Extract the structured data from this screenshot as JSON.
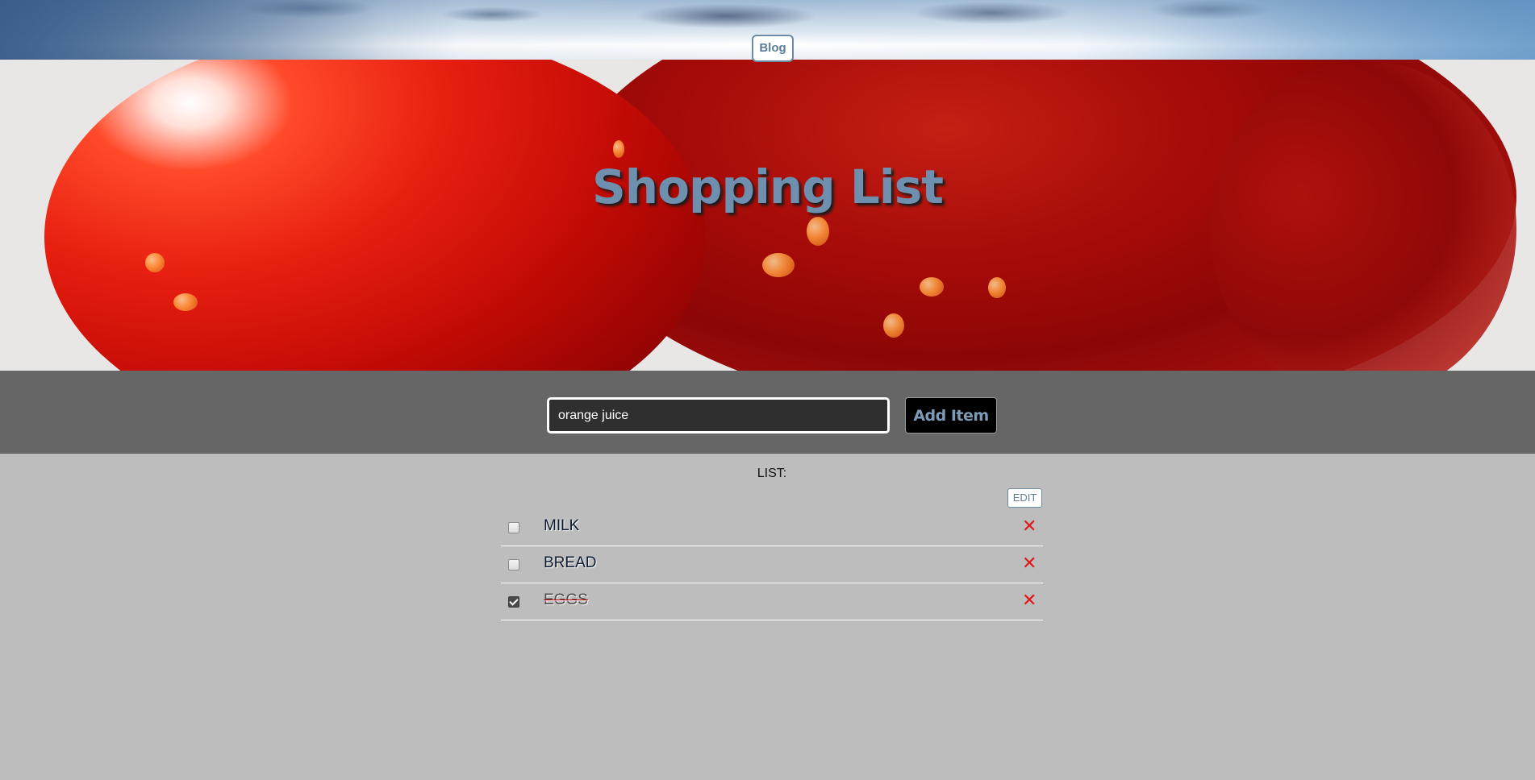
{
  "nav": {
    "blog_label": "Blog"
  },
  "header": {
    "title": "Shopping List"
  },
  "add_bar": {
    "input_value": "orange juice",
    "button_label": "Add Item"
  },
  "list": {
    "heading": "LIST:",
    "edit_label": "EDIT",
    "items": [
      {
        "label": "MILK",
        "checked": false
      },
      {
        "label": "BREAD",
        "checked": false
      },
      {
        "label": "EGGS",
        "checked": true
      }
    ],
    "delete_glyph": "✕"
  },
  "colors": {
    "title": "#6f8fae",
    "add_bar_bg": "#666666",
    "page_bg": "#bdbdbd",
    "delete": "#e0161b"
  }
}
